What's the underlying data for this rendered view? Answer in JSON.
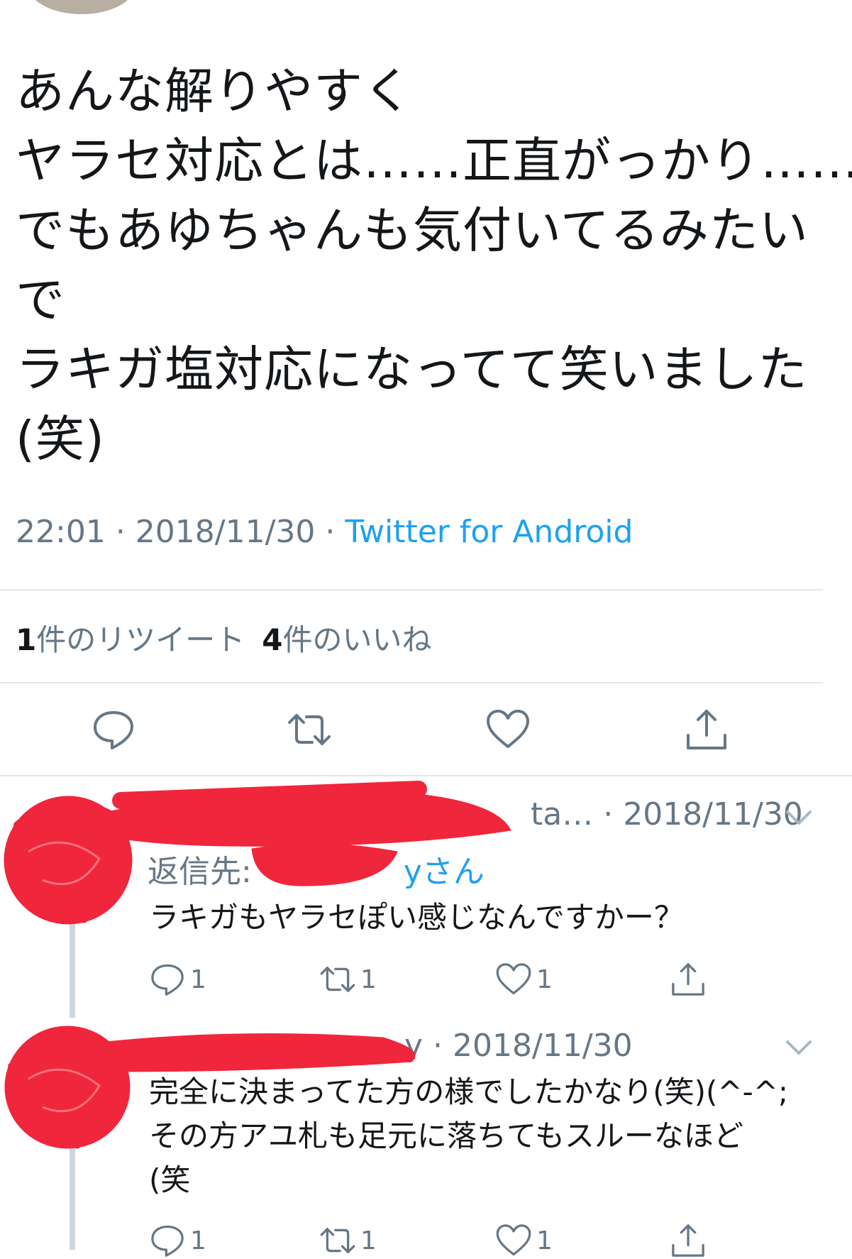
{
  "tweet": {
    "lines": [
      "あんな解りやすく",
      "ヤラセ対応とは……正直がっかり……",
      "でもあゆちゃんも気付いてるみたい",
      "で",
      "ラキガ塩対応になってて笑いました",
      "(笑)"
    ],
    "time": "22:01",
    "date": "2018/11/30",
    "source": "Twitter for Android"
  },
  "stats": {
    "retweet_count": "1",
    "retweet_label": "件のリツイート",
    "like_count": "4",
    "like_label": "件のいいね"
  },
  "actions": {
    "reply_icon": "reply-icon",
    "retweet_icon": "retweet-icon",
    "like_icon": "heart-icon",
    "share_icon": "share-icon"
  },
  "replies": [
    {
      "name_partial": "ta…",
      "date": "2018/11/30",
      "reply_to_label": "返信先:",
      "reply_to_handle_partial": "yさん",
      "lines": [
        "ラキガもヤラセぽい感じなんですかー？"
      ],
      "reply_count": "1",
      "retweet_count": "1",
      "like_count": "1"
    },
    {
      "name_partial": "y",
      "date": "2018/11/30",
      "lines": [
        "完全に決まってた方の様でしたかなり(笑)(^-^;",
        "その方アユ札も足元に落ちてもスルーなほど",
        "(笑"
      ],
      "reply_count": "1",
      "retweet_count": "1",
      "like_count": "1"
    }
  ],
  "colors": {
    "accent": "#1da1f2",
    "muted": "#657786",
    "text": "#14171a",
    "divider": "#e1e8ed",
    "redaction": "#f0263c"
  }
}
